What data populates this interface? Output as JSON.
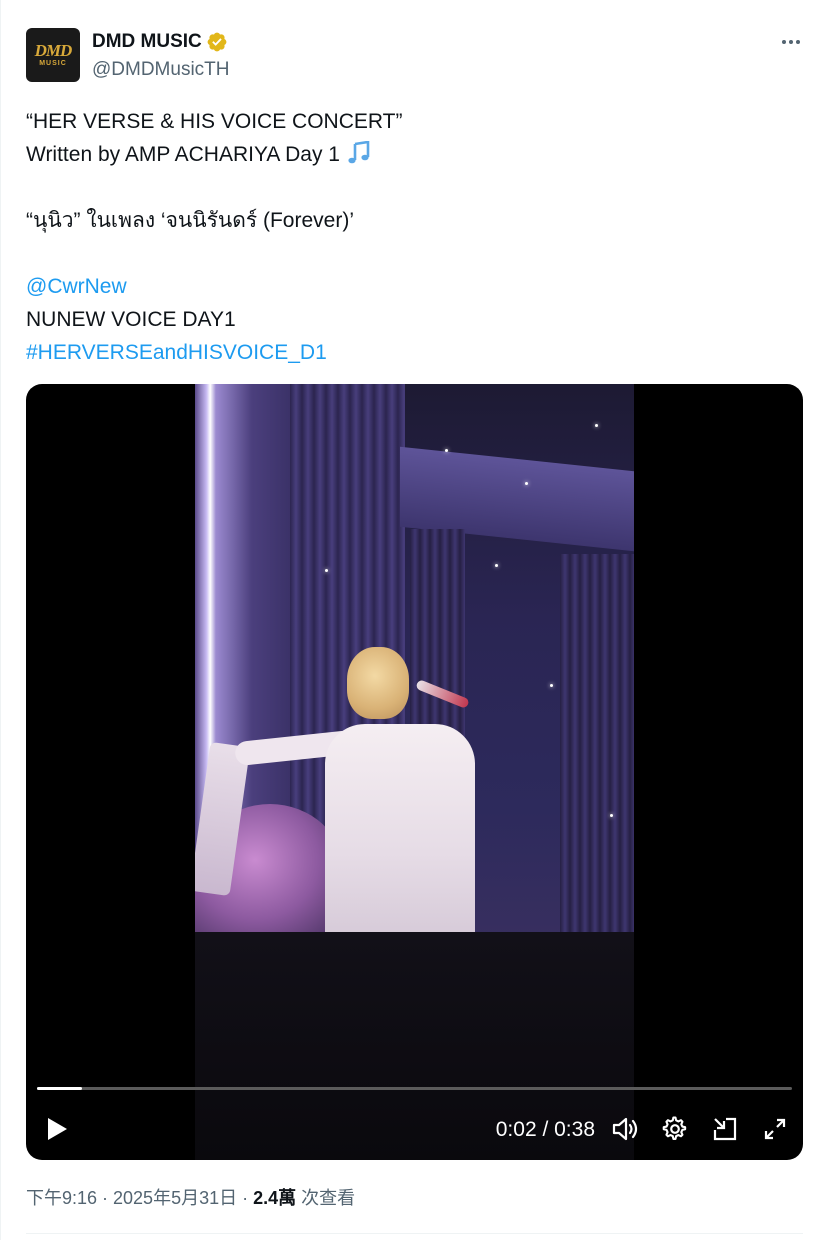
{
  "author": {
    "display_name": "DMD MUSIC",
    "handle": "@DMDMusicTH",
    "verified": true,
    "avatar_text_main": "DMD",
    "avatar_text_sub": "MUSIC",
    "verified_color": "#e2b719"
  },
  "menu_icon": "more-horizontal-icon",
  "tweet": {
    "line1": "“HER VERSE & HIS VOICE CONCERT”",
    "line2": "Written by AMP ACHARIYA Day 1",
    "line2_icon": "music-notes-emoji",
    "line3": "“นุนิว” ในเพลง ‘จนนิรันดร์ (Forever)’",
    "mention": "@CwrNew",
    "line5": "NUNEW VOICE DAY1",
    "hashtag": "#HERVERSEandHISVOICE_D1",
    "link_color": "#1d9bf0"
  },
  "video": {
    "time_display": "0:02 / 0:38",
    "progress_fraction": 0.06,
    "controls": {
      "play": "play-icon",
      "volume": "volume-icon",
      "settings": "gear-icon",
      "pip": "picture-in-picture-icon",
      "fullscreen": "fullscreen-icon"
    }
  },
  "meta": {
    "timestamp": "下午9:16 · 2025年5月31日 · ",
    "views_count": "2.4萬",
    "views_label": " 次查看"
  }
}
